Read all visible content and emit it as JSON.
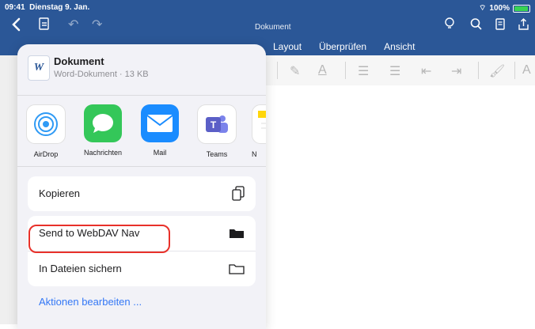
{
  "status_bar": {
    "time": "09:41",
    "date": "Dienstag 9. Jan.",
    "battery": "100%"
  },
  "app": {
    "document_title": "Dokument",
    "tabs": [
      "Layout",
      "Überprüfen",
      "Ansicht"
    ]
  },
  "share_sheet": {
    "file_name": "Dokument",
    "file_info": "Word-Dokument · 13 KB",
    "apps": [
      {
        "label": "AirDrop",
        "icon": "airdrop-icon",
        "color": "#2f9af5"
      },
      {
        "label": "Nachrichten",
        "icon": "messages-icon",
        "color": "#34c759"
      },
      {
        "label": "Mail",
        "icon": "mail-icon",
        "color": "#1a8cff"
      },
      {
        "label": "Teams",
        "icon": "teams-icon",
        "color": "#5b5fc7"
      }
    ],
    "actions": {
      "copy": "Kopieren",
      "webdav": "Send to WebDAV Nav",
      "files": "In Dateien sichern"
    },
    "edit_actions": "Aktionen bearbeiten ..."
  },
  "colors": {
    "word_blue": "#2b5797",
    "highlight_red": "#e8312a",
    "link_blue": "#3478f6"
  }
}
